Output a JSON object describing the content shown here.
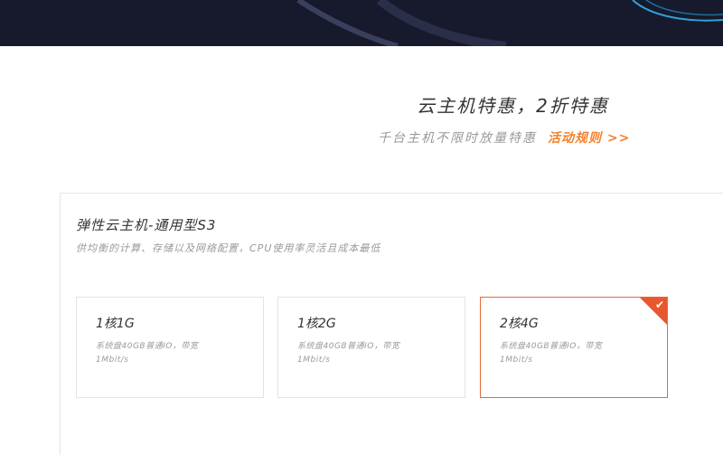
{
  "promo": {
    "title": "云主机特惠，2折特惠",
    "subtitle": "千台主机不限时放量特惠",
    "link_label": "活动规则 >>"
  },
  "product": {
    "title": "弹性云主机-通用型S3",
    "description": "供均衡的计算、存储以及网络配置，CPU使用率灵活且成本最低"
  },
  "specs": [
    {
      "name": "1核1G",
      "detail_line1": "系统盘40GB普通IO，带宽",
      "detail_line2": "1Mbit/s",
      "selected": false
    },
    {
      "name": "1核2G",
      "detail_line1": "系统盘40GB普通IO，带宽",
      "detail_line2": "1Mbit/s",
      "selected": false
    },
    {
      "name": "2核4G",
      "detail_line1": "系统盘40GB普通IO，带宽",
      "detail_line2": "1Mbit/s",
      "selected": true
    }
  ],
  "icons": {
    "selected_check": "check-icon"
  },
  "colors": {
    "accent": "#f5802a",
    "selected_border": "#e56a38",
    "banner_bg": "#161a2c"
  }
}
